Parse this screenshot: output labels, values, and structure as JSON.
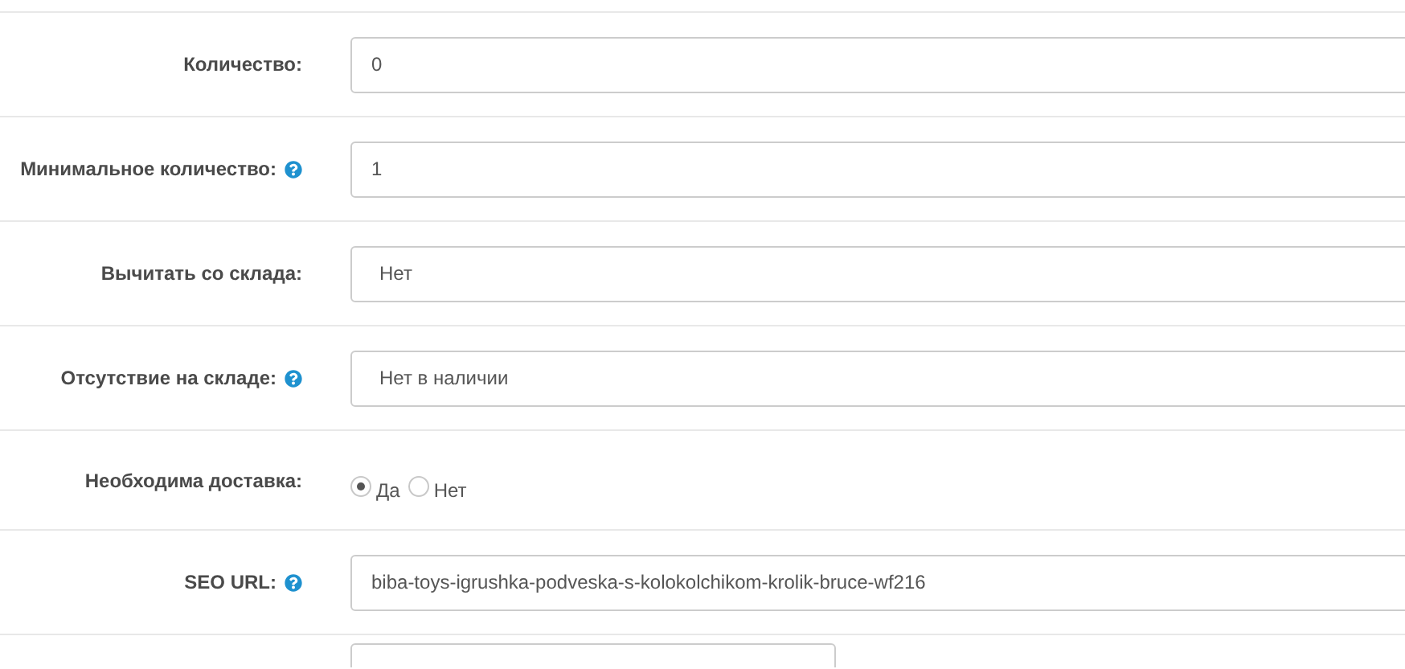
{
  "rows": [
    {
      "kind": "input",
      "label": "Количество:",
      "help": false,
      "value": "0"
    },
    {
      "kind": "input",
      "label": "Минимальное количество:",
      "help": true,
      "value": "1"
    },
    {
      "kind": "select",
      "label": "Вычитать со склада:",
      "help": false,
      "value": "Нет"
    },
    {
      "kind": "select",
      "label": "Отсутствие на складе:",
      "help": true,
      "value": "Нет в наличии"
    },
    {
      "kind": "radio",
      "label": "Необходима доставка:",
      "help": false,
      "options": [
        {
          "label": "Да",
          "selected": true
        },
        {
          "label": "Нет",
          "selected": false
        }
      ]
    },
    {
      "kind": "input",
      "label": "SEO URL:",
      "help": true,
      "value": "biba-toys-igrushka-podveska-s-kolokolchikom-krolik-bruce-wf216"
    },
    {
      "kind": "partial"
    }
  ]
}
